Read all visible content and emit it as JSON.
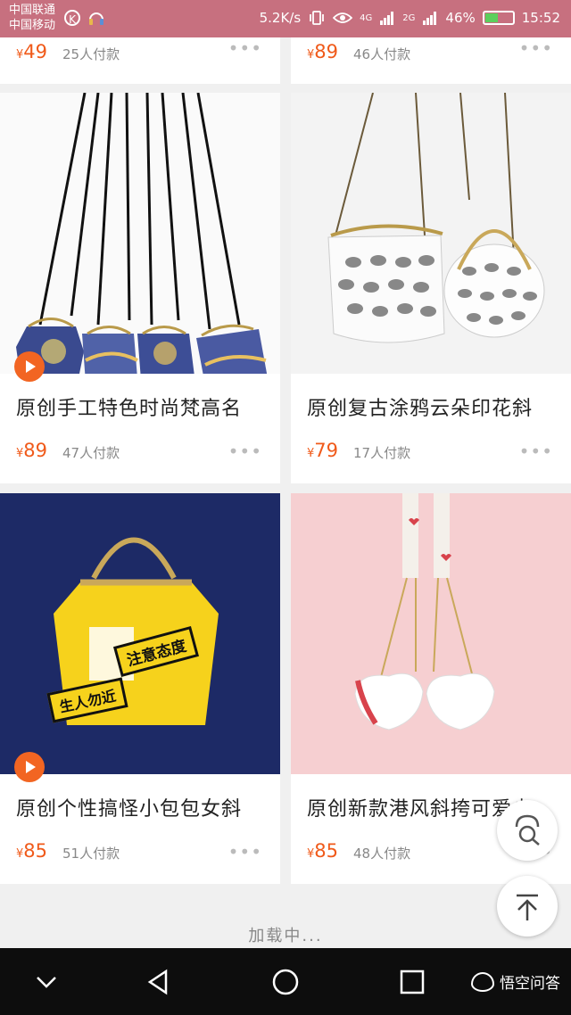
{
  "status_bar": {
    "carrier_1": "中国联通",
    "carrier_2": "中国移动",
    "k_label": "K",
    "net_speed": "5.2K/s",
    "signal_4g": "4G",
    "signal_2g": "2G",
    "battery_percent": "46%",
    "battery_level": 0.46,
    "time": "15:52"
  },
  "top_row": [
    {
      "price_symbol": "¥",
      "price": "49",
      "sold": "25人付款"
    },
    {
      "price_symbol": "¥",
      "price": "89",
      "sold": "46人付款"
    }
  ],
  "products": [
    {
      "title": "原创手工特色时尚梵高名",
      "price_symbol": "¥",
      "price": "89",
      "sold": "47人付款",
      "has_video": true
    },
    {
      "title": "原创复古涂鸦云朵印花斜",
      "price_symbol": "¥",
      "price": "79",
      "sold": "17人付款",
      "has_video": false
    },
    {
      "title": "原创个性搞怪小包包女斜",
      "price_symbol": "¥",
      "price": "85",
      "sold": "51人付款",
      "has_video": true,
      "image_text": [
        "注意态度",
        "生人勿近"
      ]
    },
    {
      "title": "原创新款港风斜挎可爱少",
      "price_symbol": "¥",
      "price": "85",
      "sold": "48人付款",
      "has_video": false
    }
  ],
  "more_label": "•••",
  "loading_text": "加载中...",
  "nav": {
    "brand": "悟空问答",
    "back_icon": "triangle-back-icon",
    "home_icon": "circle-home-icon",
    "recent_icon": "square-recent-icon",
    "collapse_icon": "chevron-down-icon"
  },
  "colors": {
    "status_bar": "#c7707f",
    "price": "#f05a1a",
    "play": "#f26522"
  }
}
